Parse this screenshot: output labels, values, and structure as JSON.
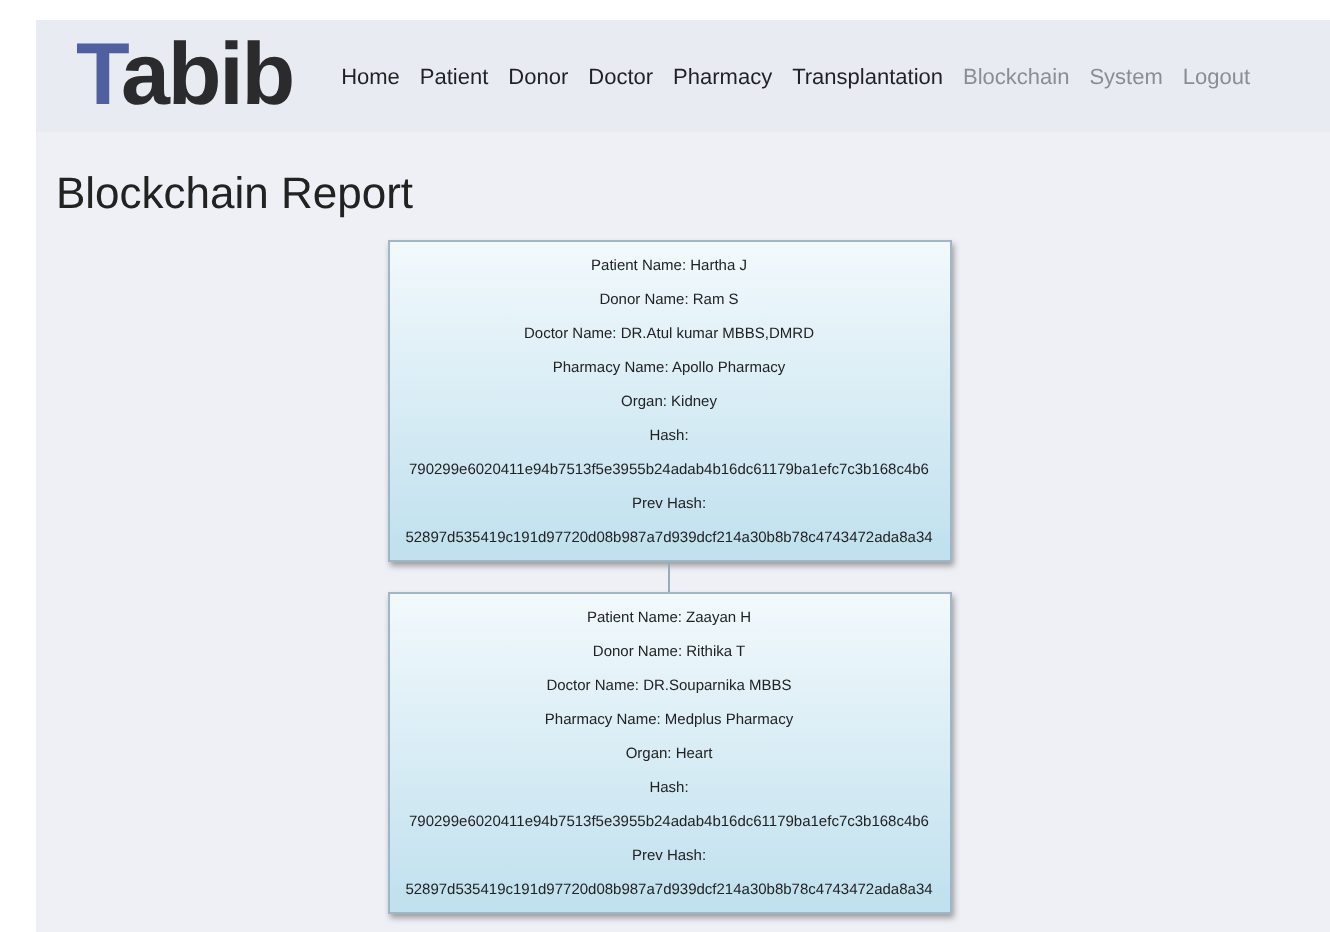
{
  "logo": "Tabib",
  "nav": [
    {
      "label": "Home",
      "disabled": false
    },
    {
      "label": "Patient",
      "disabled": false
    },
    {
      "label": "Donor",
      "disabled": false
    },
    {
      "label": "Doctor",
      "disabled": false
    },
    {
      "label": "Pharmacy",
      "disabled": false
    },
    {
      "label": "Transplantation",
      "disabled": false
    },
    {
      "label": "Blockchain",
      "disabled": true
    },
    {
      "label": "System",
      "disabled": true
    },
    {
      "label": "Logout",
      "disabled": true
    }
  ],
  "title": "Blockchain Report",
  "blocks": [
    {
      "lines": [
        "Patient Name: Hartha J",
        "Donor Name: Ram S",
        "Doctor Name: DR.Atul kumar MBBS,DMRD",
        "Pharmacy Name: Apollo Pharmacy",
        "Organ: Kidney",
        "Hash:",
        "790299e6020411e94b7513f5e3955b24adab4b16dc61179ba1efc7c3b168c4b6",
        "Prev Hash:",
        "52897d535419c191d97720d08b987a7d939dcf214a30b8b78c4743472ada8a34"
      ]
    },
    {
      "lines": [
        "Patient Name: Zaayan H",
        "Donor Name: Rithika T",
        "Doctor Name: DR.Souparnika MBBS",
        "Pharmacy Name: Medplus Pharmacy",
        "Organ: Heart",
        "Hash:",
        "790299e6020411e94b7513f5e3955b24adab4b16dc61179ba1efc7c3b168c4b6",
        "Prev Hash:",
        "52897d535419c191d97720d08b987a7d939dcf214a30b8b78c4743472ada8a34"
      ]
    }
  ]
}
